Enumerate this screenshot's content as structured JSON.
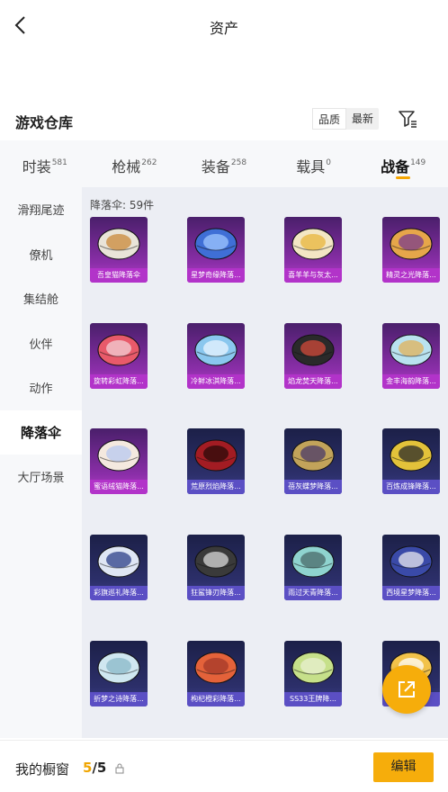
{
  "header": {
    "title": "资产",
    "back_icon": "chevron-left-icon"
  },
  "section": {
    "title": "游戏仓库",
    "sort_quality": "品质",
    "sort_latest": "最新",
    "filter_icon": "filter-icon"
  },
  "tabs": [
    {
      "label": "时装",
      "count": "581",
      "active": false
    },
    {
      "label": "枪械",
      "count": "262",
      "active": false
    },
    {
      "label": "装备",
      "count": "258",
      "active": false
    },
    {
      "label": "载具",
      "count": "0",
      "active": false
    },
    {
      "label": "战备",
      "count": "149",
      "active": true
    }
  ],
  "sidebar": [
    {
      "label": "滑翔尾迹",
      "active": false
    },
    {
      "label": "僚机",
      "active": false
    },
    {
      "label": "集结舱",
      "active": false
    },
    {
      "label": "伙伴",
      "active": false
    },
    {
      "label": "动作",
      "active": false
    },
    {
      "label": "降落伞",
      "active": true
    },
    {
      "label": "大厅场景",
      "active": false
    }
  ],
  "content": {
    "count_label": "降落伞: 59件",
    "items": [
      {
        "name": "吾皇猫降落伞",
        "quality": "purple",
        "c1": "#e9e4d8",
        "c2": "#c98a3a"
      },
      {
        "name": "星梦奇缘降落...",
        "quality": "purple",
        "c1": "#3f6fd6",
        "c2": "#9fc6ff"
      },
      {
        "name": "喜羊羊与灰太...",
        "quality": "purple",
        "c1": "#f3e6c4",
        "c2": "#e8b53c"
      },
      {
        "name": "精灵之光降落...",
        "quality": "purple",
        "c1": "#e6a64a",
        "c2": "#7a3b8c"
      },
      {
        "name": "旋转彩虹降落...",
        "quality": "purple",
        "c1": "#e85a6a",
        "c2": "#f3d0d6"
      },
      {
        "name": "冷鲜冰淇降落...",
        "quality": "purple",
        "c1": "#8ac7ee",
        "c2": "#e8f4ff"
      },
      {
        "name": "焰龙焚天降落...",
        "quality": "purple",
        "c1": "#2a2a2a",
        "c2": "#d24a3a"
      },
      {
        "name": "金丰海韵降落...",
        "quality": "purple",
        "c1": "#b9e2ef",
        "c2": "#e2b25a"
      },
      {
        "name": "蜜语绒猫降落...",
        "quality": "purple",
        "c1": "#f4e9df",
        "c2": "#b8c8f0"
      },
      {
        "name": "荒原烈焰降落...",
        "quality": "blue",
        "c1": "#a31c23",
        "c2": "#2a0a0a"
      },
      {
        "name": "蓓灰蝶梦降落...",
        "quality": "blue",
        "c1": "#c2a35a",
        "c2": "#4a3a6a"
      },
      {
        "name": "百炼成锋降落...",
        "quality": "blue",
        "c1": "#e3c23a",
        "c2": "#2a2a2a"
      },
      {
        "name": "彩旗巡礼降落...",
        "quality": "blue",
        "c1": "#dfe6f4",
        "c2": "#2c3f88"
      },
      {
        "name": "狂鲨锋刃降落...",
        "quality": "blue",
        "c1": "#3a3a3a",
        "c2": "#d8d8d8"
      },
      {
        "name": "雨过天青降落...",
        "quality": "blue",
        "c1": "#8fd3cf",
        "c2": "#4a6a6a"
      },
      {
        "name": "西境星梦降落...",
        "quality": "blue",
        "c1": "#3a4aa8",
        "c2": "#e8e8ef"
      },
      {
        "name": "折梦之诗降落...",
        "quality": "blue",
        "c1": "#cfe7f0",
        "c2": "#8ab8c8"
      },
      {
        "name": "枸杞橙彩降落...",
        "quality": "blue",
        "c1": "#e4623a",
        "c2": "#a43a2a"
      },
      {
        "name": "SS33王牌降...",
        "quality": "blue",
        "c1": "#c6e08a",
        "c2": "#e8f0d0"
      },
      {
        "name": "",
        "quality": "blue",
        "c1": "#f2c24a",
        "c2": "#ffffff"
      }
    ]
  },
  "fab": {
    "icon": "external-link-icon"
  },
  "bottombar": {
    "label": "我的橱窗",
    "current": "5",
    "total": "5",
    "lock_icon": "lock-icon",
    "edit_label": "编辑"
  },
  "colors": {
    "accent": "#f6ad0b",
    "purple_quality": "#b233c9",
    "blue_quality": "#5b4fc4"
  }
}
